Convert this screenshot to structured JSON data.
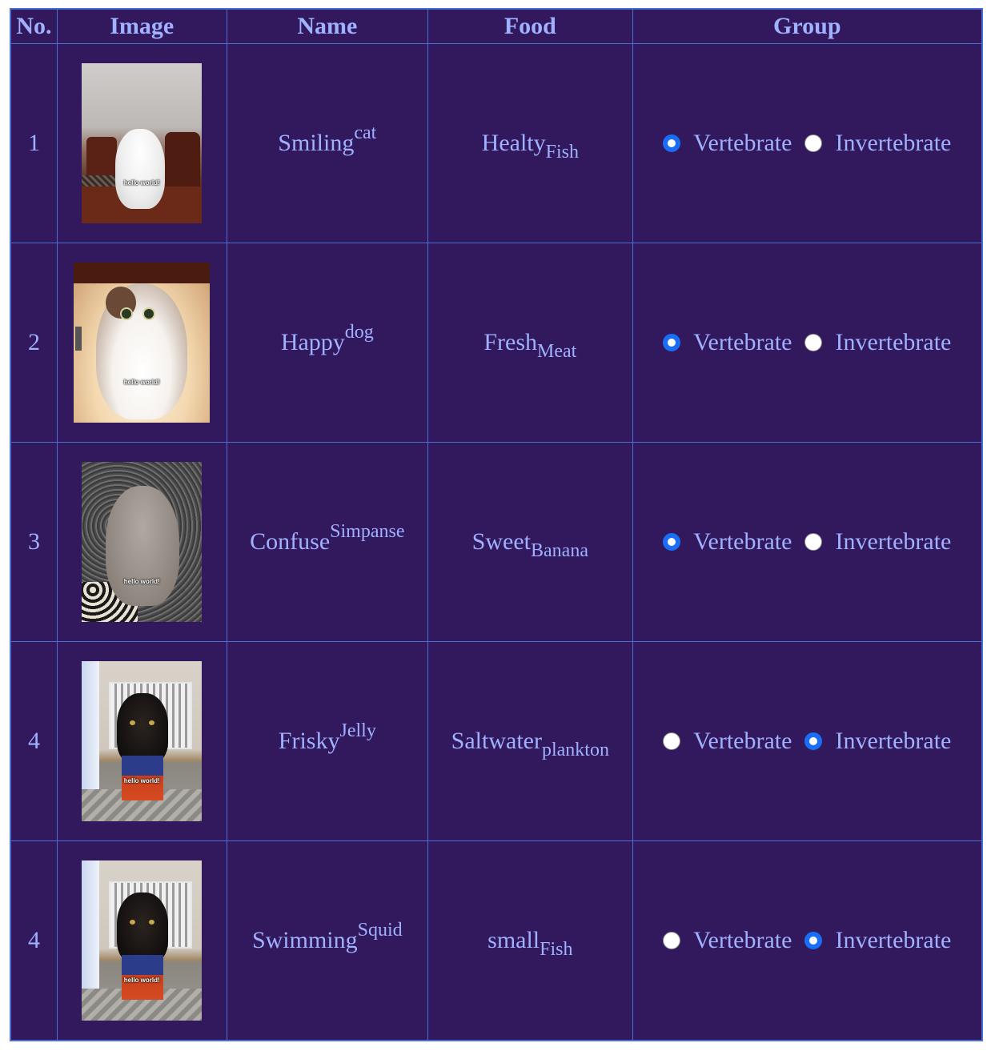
{
  "table": {
    "headers": {
      "no": "No.",
      "image": "Image",
      "name": "Name",
      "food": "Food",
      "group": "Group"
    },
    "group_options": [
      "Vertebrate",
      "Invertebrate"
    ],
    "image_caption": "hello world!",
    "rows": [
      {
        "no": "1",
        "name_main": "Smiling",
        "name_sup": "cat",
        "food_main": "Healty",
        "food_sub": "Fish",
        "group_selected": "Vertebrate",
        "photo": "white-cat-on-chair"
      },
      {
        "no": "2",
        "name_main": "Happy",
        "name_sup": "dog",
        "food_main": "Fresh",
        "food_sub": "Meat",
        "group_selected": "Vertebrate",
        "photo": "fluffy-cat-under-table"
      },
      {
        "no": "3",
        "name_main": "Confuse",
        "name_sup": "Simpanse",
        "food_main": "Sweet",
        "food_sub": "Banana",
        "group_selected": "Vertebrate",
        "photo": "grey-fold-cat"
      },
      {
        "no": "4",
        "name_main": "Frisky",
        "name_sup": "Jelly",
        "food_main": "Saltwater",
        "food_sub": "plankton",
        "group_selected": "Invertebrate",
        "photo": "black-cat-in-box"
      },
      {
        "no": "4",
        "name_main": "Swimming",
        "name_sup": "Squid",
        "food_main": "small",
        "food_sub": "Fish",
        "group_selected": "Invertebrate",
        "photo": "black-cat-in-box"
      }
    ]
  },
  "colors": {
    "table_background": "#32185c",
    "border": "#4a6fd4",
    "text": "#9fb1ff",
    "radio_checked": "#1a6ef5"
  }
}
